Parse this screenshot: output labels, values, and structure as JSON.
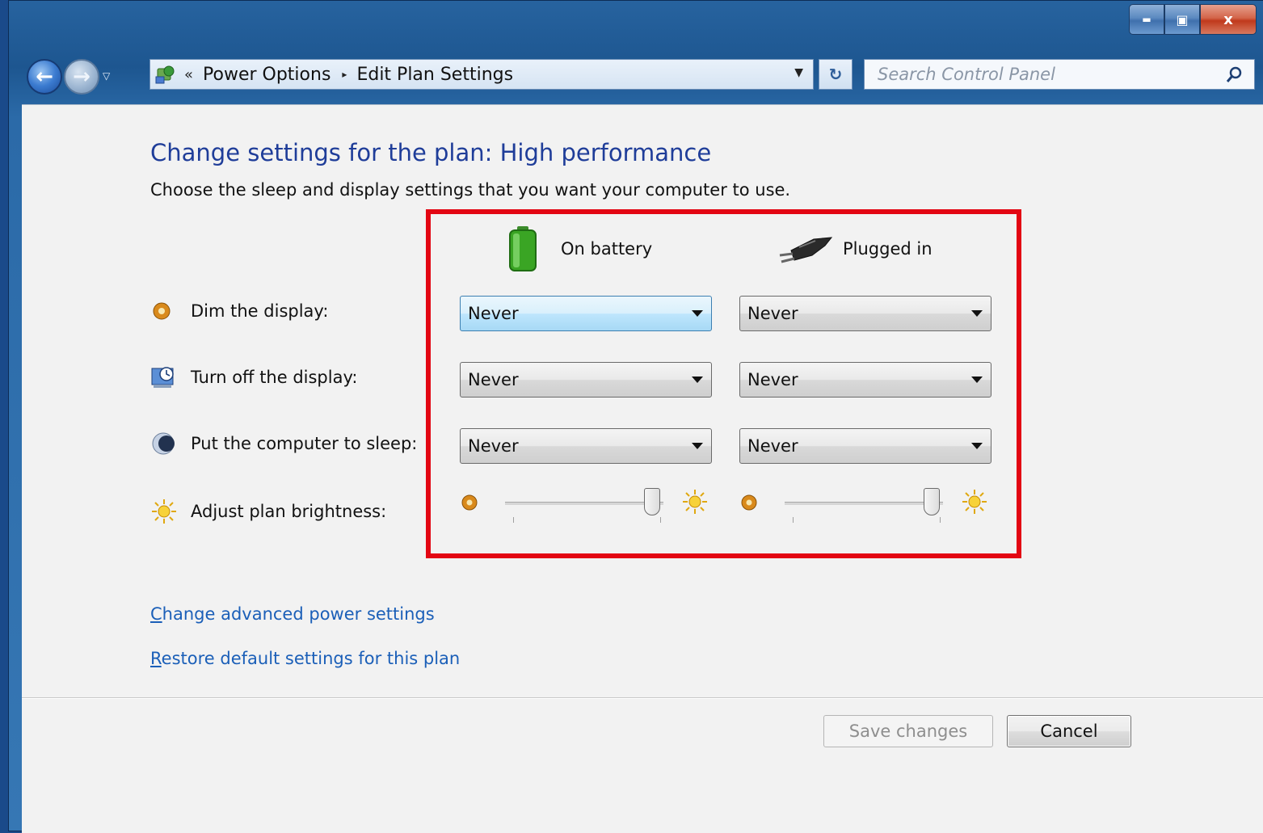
{
  "window": {
    "controls": {
      "minimize": "▬",
      "maximize": "▣",
      "close": "x"
    }
  },
  "nav": {
    "back_glyph": "←",
    "forward_glyph": "→",
    "address": {
      "chevron": "«",
      "crumbs": [
        "Power Options",
        "Edit Plan Settings"
      ],
      "separator": "▸",
      "dropdown": "▼"
    },
    "refresh_glyph": "↻",
    "search": {
      "placeholder": "Search Control Panel",
      "value": ""
    }
  },
  "page": {
    "heading": "Change settings for the plan: High performance",
    "subheading": "Choose the sleep and display settings that you want your computer to use."
  },
  "columns": {
    "battery": {
      "label": "On battery",
      "icon": "battery-icon"
    },
    "plugged": {
      "label": "Plugged in",
      "icon": "power-plug-icon"
    }
  },
  "settings": [
    {
      "label": "Dim the display:",
      "icon": "dim-display-icon",
      "battery": "Never",
      "plugged": "Never"
    },
    {
      "label": "Turn off the display:",
      "icon": "monitor-clock-icon",
      "battery": "Never",
      "plugged": "Never"
    },
    {
      "label": "Put the computer to sleep:",
      "icon": "sleep-moon-icon",
      "battery": "Never",
      "plugged": "Never"
    }
  ],
  "brightness": {
    "label": "Adjust plan brightness:",
    "icon": "brightness-sun-icon",
    "battery_level": 0.93,
    "plugged_level": 0.93
  },
  "links": {
    "advanced": {
      "first": "C",
      "rest": "hange advanced power settings"
    },
    "restore": {
      "first": "R",
      "rest": "estore default settings for this plan"
    }
  },
  "buttons": {
    "save": "Save changes",
    "cancel": "Cancel"
  },
  "colors": {
    "heading": "#1f3d99",
    "link": "#1b5fb8",
    "highlight_box": "#e30613",
    "content_bg": "#f2f2f2"
  }
}
